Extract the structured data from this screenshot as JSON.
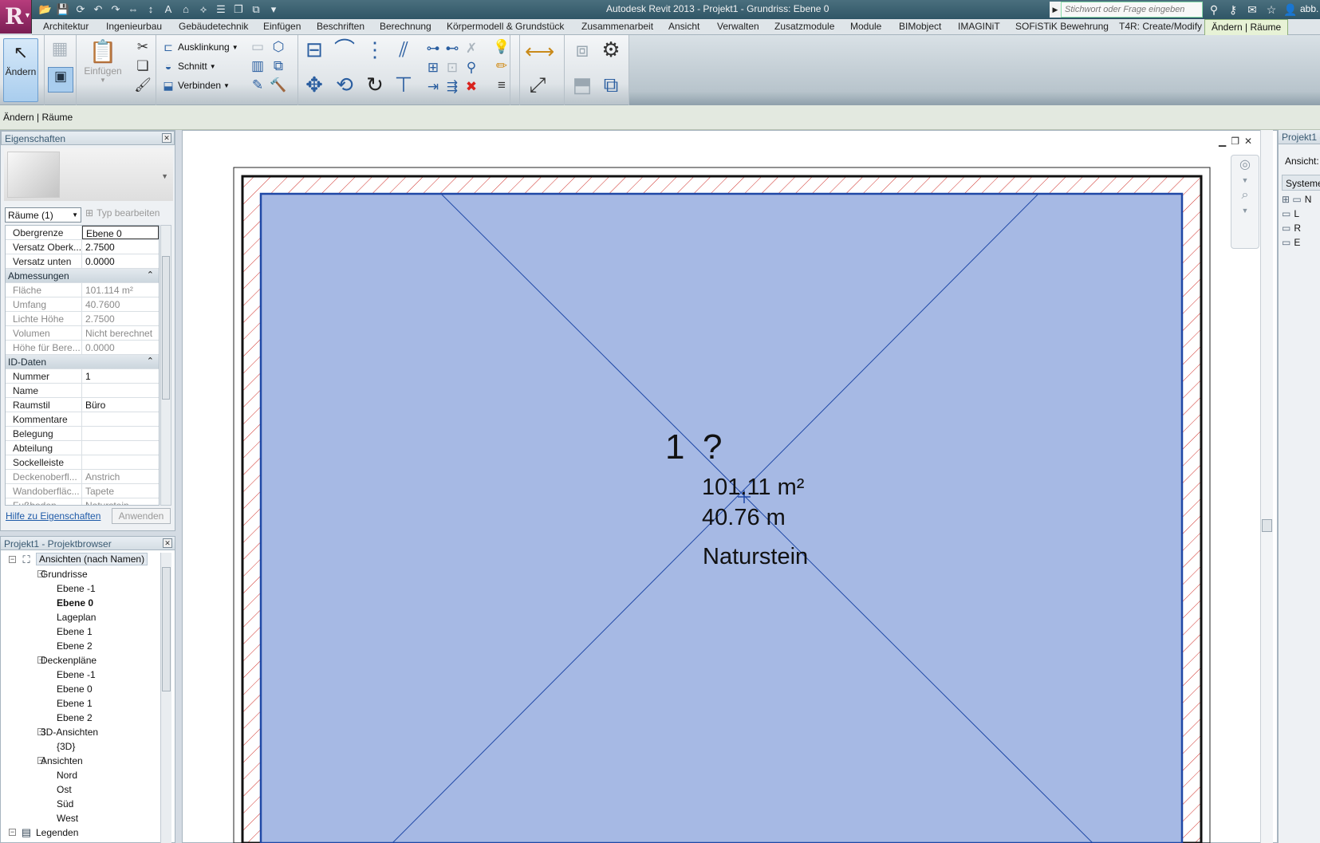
{
  "app": {
    "window_title": "Autodesk Revit 2013 -    Projekt1 - Grundriss: Ebene 0",
    "search_placeholder": "Stichwort oder Frage eingeben",
    "user": "abb."
  },
  "ribbon_tabs": [
    "Architektur",
    "Ingenieurbau",
    "Gebäudetechnik",
    "Einfügen",
    "Beschriften",
    "Berechnung",
    "Körpermodell & Grundstück",
    "Zusammenarbeit",
    "Ansicht",
    "Verwalten",
    "Zusatzmodule",
    "Module",
    "BIMobject",
    "IMAGINiT",
    "SOFiSTiK Bewehrung",
    "T4R: Create/Modify",
    "Ändern | Räume"
  ],
  "ribbon": {
    "modify_label": "Ändern",
    "paste_label": "Einfügen",
    "ausklinkung_label": "Ausklinkung",
    "schnitt_label": "Schnitt",
    "verbinden_label": "Verbinden"
  },
  "options_bar": {
    "context": "Ändern | Räume"
  },
  "properties": {
    "title": "Eigenschaften",
    "type_selector": "Räume (1)",
    "edit_type": "Typ bearbeiten",
    "rows": [
      {
        "k": "Obergrenze",
        "v": "Ebene 0",
        "type": "edit"
      },
      {
        "k": "Versatz Oberk...",
        "v": "2.7500",
        "type": "normal"
      },
      {
        "k": "Versatz unten",
        "v": "0.0000",
        "type": "normal"
      },
      {
        "k": "Abmessungen",
        "v": "",
        "type": "section"
      },
      {
        "k": "Fläche",
        "v": "101.114 m²",
        "type": "ro"
      },
      {
        "k": "Umfang",
        "v": "40.7600",
        "type": "ro"
      },
      {
        "k": "Lichte Höhe",
        "v": "2.7500",
        "type": "ro"
      },
      {
        "k": "Volumen",
        "v": "Nicht berechnet",
        "type": "ro"
      },
      {
        "k": "Höhe für Bere...",
        "v": "0.0000",
        "type": "ro"
      },
      {
        "k": "ID-Daten",
        "v": "",
        "type": "section"
      },
      {
        "k": "Nummer",
        "v": "1",
        "type": "normal"
      },
      {
        "k": "Name",
        "v": "",
        "type": "normal"
      },
      {
        "k": "Raumstil",
        "v": "Büro",
        "type": "normal"
      },
      {
        "k": "Kommentare",
        "v": "",
        "type": "normal"
      },
      {
        "k": "Belegung",
        "v": "",
        "type": "normal"
      },
      {
        "k": "Abteilung",
        "v": "",
        "type": "normal"
      },
      {
        "k": "Sockelleiste",
        "v": "",
        "type": "normal"
      },
      {
        "k": "Deckenoberfl...",
        "v": "Anstrich",
        "type": "ro"
      },
      {
        "k": "Wandoberfläc...",
        "v": "Tapete",
        "type": "ro"
      },
      {
        "k": "Fußboden",
        "v": "Naturstein",
        "type": "ro"
      }
    ],
    "help_link": "Hilfe zu Eigenschaften",
    "apply": "Anwenden"
  },
  "browser": {
    "title": "Projekt1 - Projektbrowser",
    "items": [
      {
        "label": "Ansichten (nach Namen)",
        "level": 0,
        "box": "−",
        "icon": "views-icon",
        "glyph": "⛶",
        "style": "sel"
      },
      {
        "label": "Grundrisse",
        "level": 1,
        "box": "−"
      },
      {
        "label": "Ebene -1",
        "level": 2
      },
      {
        "label": "Ebene 0",
        "level": 2,
        "style": "bold"
      },
      {
        "label": "Lageplan",
        "level": 2
      },
      {
        "label": "Ebene 1",
        "level": 2
      },
      {
        "label": "Ebene 2",
        "level": 2
      },
      {
        "label": "Deckenpläne",
        "level": 1,
        "box": "−"
      },
      {
        "label": "Ebene -1",
        "level": 2
      },
      {
        "label": "Ebene 0",
        "level": 2
      },
      {
        "label": "Ebene 1",
        "level": 2
      },
      {
        "label": "Ebene 2",
        "level": 2
      },
      {
        "label": "3D-Ansichten",
        "level": 1,
        "box": "−"
      },
      {
        "label": "{3D}",
        "level": 2
      },
      {
        "label": "Ansichten",
        "level": 1,
        "box": "−"
      },
      {
        "label": "Nord",
        "level": 2
      },
      {
        "label": "Ost",
        "level": 2
      },
      {
        "label": "Süd",
        "level": 2
      },
      {
        "label": "West",
        "level": 2
      },
      {
        "label": "Legenden",
        "level": 0,
        "box": "−",
        "icon": "legend-icon",
        "glyph": "▤"
      }
    ]
  },
  "room_tag": {
    "number": "1",
    "name": "?",
    "area": "101.11 m²",
    "perimeter": "40.76 m",
    "floor_finish": "Naturstein"
  },
  "right_panel": {
    "title": "Projekt1 -",
    "view_label": "Ansicht:",
    "systems": "Systeme",
    "rows": [
      "N",
      "L",
      "R",
      "E"
    ]
  },
  "colors": {
    "room_fill": "#a6b9e4",
    "room_outline": "#1f48a6",
    "hatch": "#d0302a",
    "active_tab": "#e7f2d6"
  }
}
